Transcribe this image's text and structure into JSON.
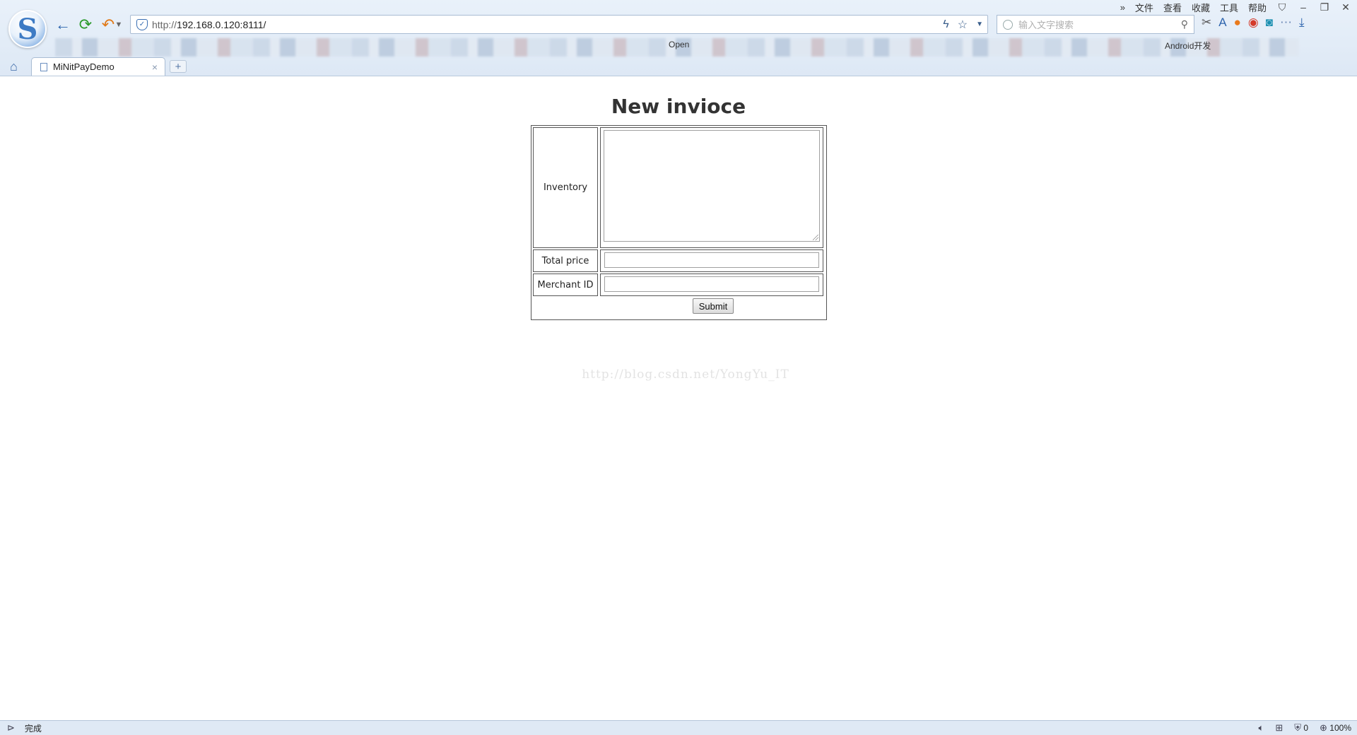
{
  "browser": {
    "menu": [
      "文件",
      "查看",
      "收藏",
      "工具",
      "帮助"
    ],
    "url_proto": "http://",
    "url_host": "192.168.0.120:8111/",
    "search_placeholder": "输入文字搜索",
    "bookmark_open": "Open",
    "bookmark_android": "Android开发"
  },
  "tab": {
    "title": "MiNitPayDemo",
    "close": "×",
    "new": "+"
  },
  "page": {
    "title": "New invioce",
    "labels": {
      "inventory": "Inventory",
      "total_price": "Total price",
      "merchant_id": "Merchant ID"
    },
    "values": {
      "inventory": "",
      "total_price": "",
      "merchant_id": ""
    },
    "submit_label": "Submit",
    "watermark": "http://blog.csdn.net/YongYu_IT"
  },
  "status": {
    "text": "完成",
    "shield_count": "0",
    "zoom": "100%"
  },
  "colors": {
    "chrome_bg": "#dde8f5",
    "accent": "#3e7bc4",
    "refresh_green": "#2a9a2a",
    "undo_orange": "#e07b1a"
  }
}
